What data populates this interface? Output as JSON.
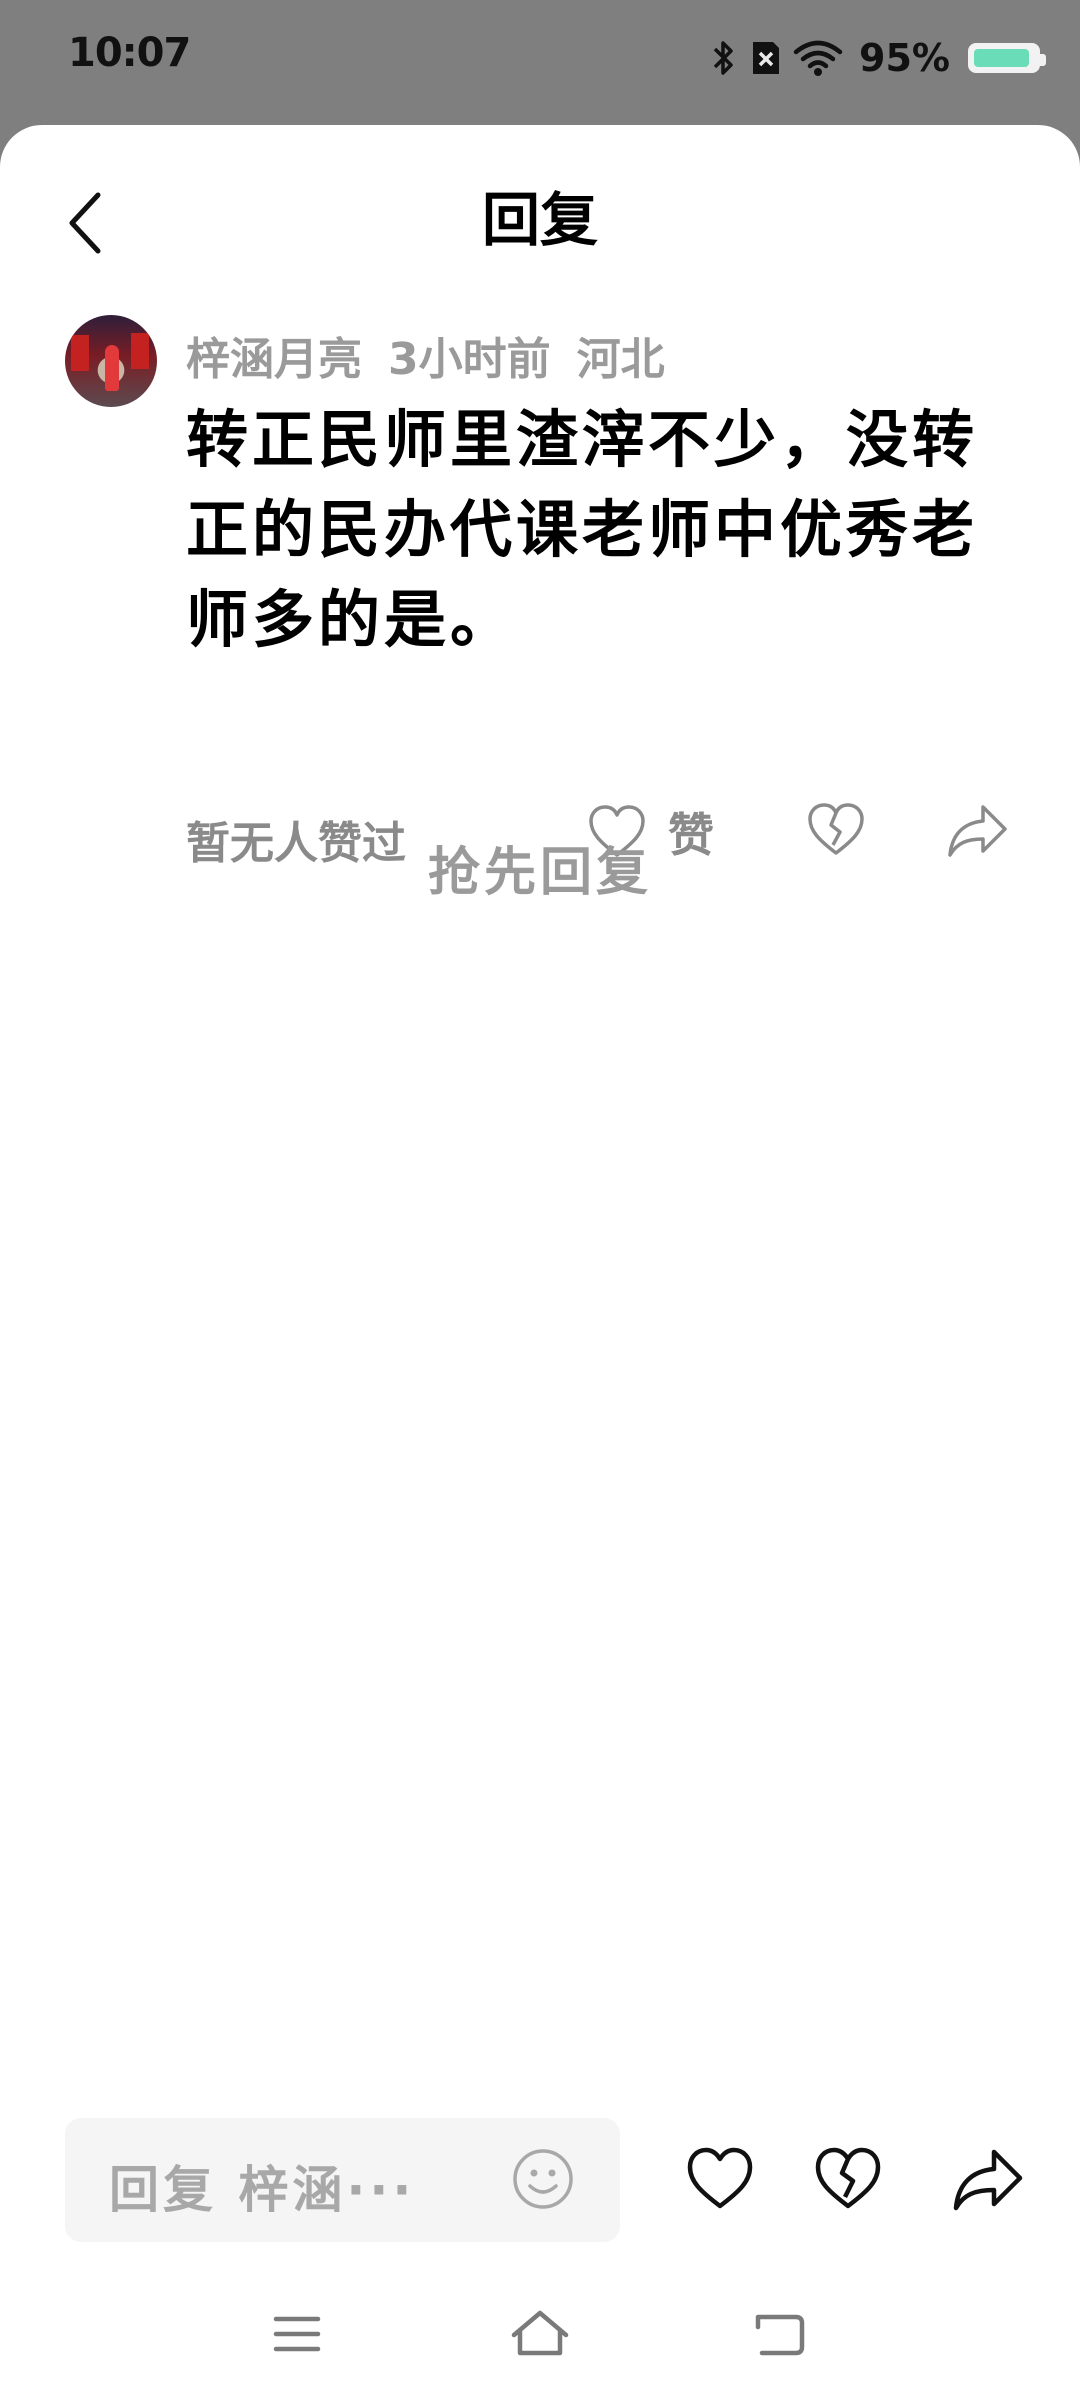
{
  "status_bar": {
    "time": "10:07",
    "battery_percent": "95%",
    "battery_level": 0.95,
    "icons": [
      "bluetooth-icon",
      "sim-off-icon",
      "wifi-icon",
      "battery-icon"
    ],
    "battery_color": "#6bdcb8"
  },
  "header": {
    "title": "回复",
    "back_icon": "chevron-left-icon"
  },
  "comment": {
    "author": "梓涵月亮",
    "time_ago": "3小时前",
    "location": "河北",
    "text": "转正民师里渣滓不少，没转正的民办代课老师中优秀老师多的是。",
    "likes_text": "暂无人赞过",
    "like_label": "赞"
  },
  "empty_state": {
    "first_reply": "抢先回复"
  },
  "bottom_bar": {
    "reply_placeholder": "回复 梓涵···",
    "icons": [
      "emoji-icon",
      "heart-icon",
      "broken-heart-icon",
      "share-icon"
    ]
  },
  "nav_bar": {
    "icons": [
      "menu-icon",
      "home-icon",
      "back-icon"
    ]
  }
}
